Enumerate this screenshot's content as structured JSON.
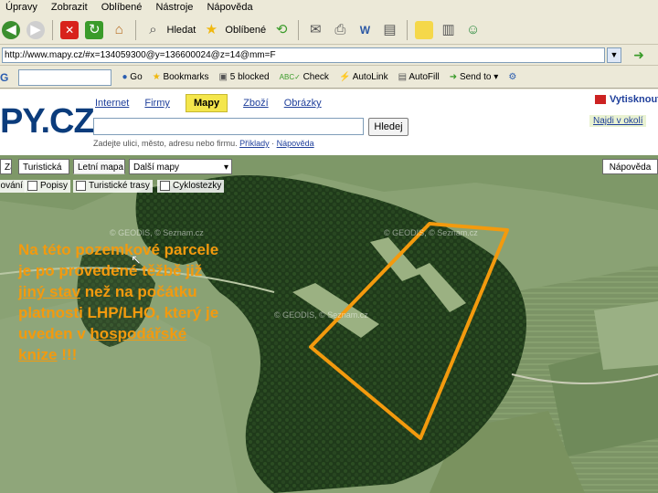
{
  "menu": [
    "Úpravy",
    "Zobrazit",
    "Oblíbené",
    "Nástroje",
    "Nápověda"
  ],
  "toolbar": {
    "search_label": "Hledat",
    "favorites_label": "Oblíbené"
  },
  "address": {
    "url": "http://www.mapy.cz/#x=134059300@y=136600024@z=14@mm=F"
  },
  "google_toolbar": {
    "go_label": "Go",
    "bookmarks_label": "Bookmarks",
    "blocked_label": "5 blocked",
    "check_label": "Check",
    "autolink_label": "AutoLink",
    "autofill_label": "AutoFill",
    "sendto_label": "Send to"
  },
  "site": {
    "logo": "PY.CZ",
    "nav": [
      "Internet",
      "Firmy",
      "Mapy",
      "Zboží",
      "Obrázky"
    ],
    "active_nav": "Mapy",
    "search_placeholder": "",
    "search_button": "Hledej",
    "hint_text": "Zadejte ulici, město, adresu nebo firmu.",
    "hint_examples": "Příklady",
    "hint_help": "Nápověda",
    "print_link": "Vytisknout",
    "nearby_link": "Najdi v okolí"
  },
  "map": {
    "tabs": [
      "Zákl",
      "Turistická",
      "Letní mapa",
      "Další mapy"
    ],
    "help_tab": "Nápověda",
    "checkboxes": [
      "Stínování",
      "Popisy",
      "Turistické trasy",
      "Cyklostezky"
    ],
    "watermark": "© GEODIS, © Seznam.cz"
  },
  "annotation": {
    "line1": "Na této pozemkové parcele",
    "line2": "je po provedené těžbě již",
    "line3_u": "jiný stav",
    "line3_rest": " než na počátku",
    "line4": "platnosti LHP/LHO, který je",
    "line5_a": "uveden v ",
    "line5_u": "hospodářské",
    "line6_u": "knize",
    "line6_rest": " !!!"
  },
  "colors": {
    "annotation": "#f39a0e",
    "highlight_polygon": "#f39a0e",
    "active_nav_bg": "#f4e64c"
  }
}
